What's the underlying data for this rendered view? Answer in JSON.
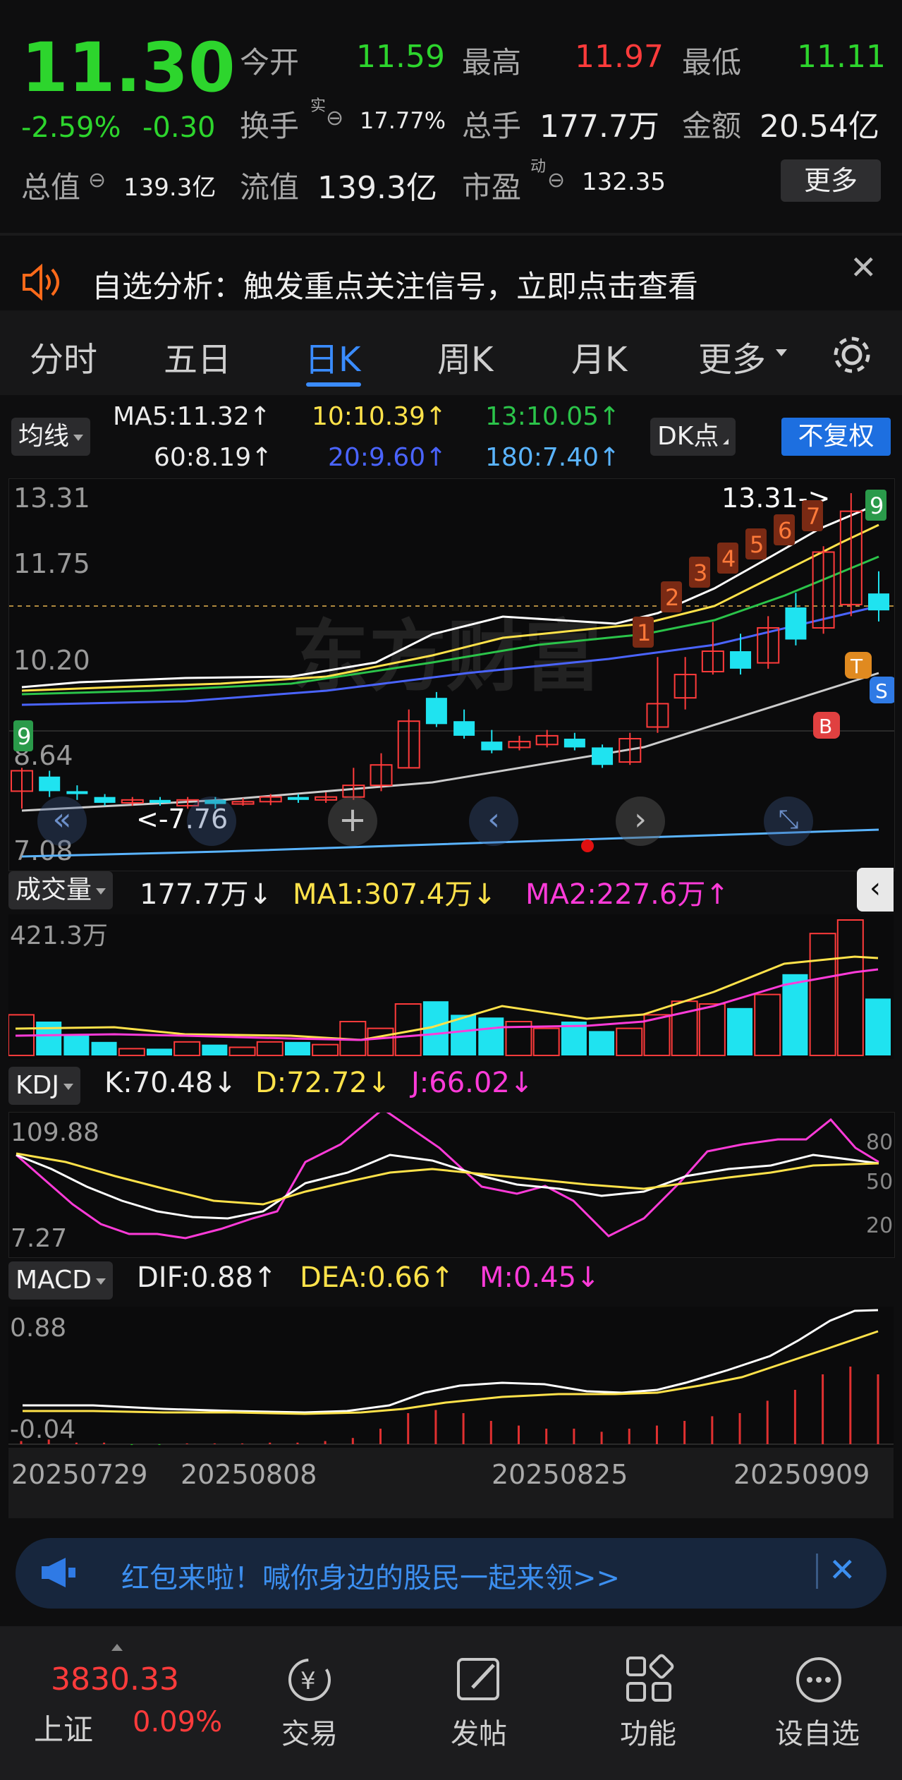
{
  "quote": {
    "price": "11.30",
    "change_pct": "-2.59%",
    "change": "-0.30",
    "open_label": "今开",
    "open": "11.59",
    "high_label": "最高",
    "high": "11.97",
    "low_label": "最低",
    "low": "11.11",
    "turnover_label": "换手",
    "turnover_sup": "实",
    "turnover": "17.77%",
    "volume_label": "总手",
    "volume": "177.7万",
    "amount_label": "金额",
    "amount": "20.54亿",
    "mktcap_label": "总值",
    "mktcap": "139.3亿",
    "float_label": "流值",
    "float": "139.3亿",
    "pe_label": "市盈",
    "pe_sup": "动",
    "pe": "132.35",
    "more_button": "更多"
  },
  "notice": {
    "text": "自选分析：触发重点关注信号，立即点击查看"
  },
  "tabs": [
    "分时",
    "五日",
    "日K",
    "周K",
    "月K",
    "更多"
  ],
  "active_tab": "日K",
  "ma_panel": {
    "selector": "均线",
    "ma5": "MA5:11.32↑",
    "ma10": "10:10.39↑",
    "ma13": "13:10.05↑",
    "ma60": "60:8.19↑",
    "ma20": "20:9.60↑",
    "ma180": "180:7.40↑",
    "dk_button": "DK点",
    "fq_button": "不复权"
  },
  "price_chart_labels": {
    "y_top": "13.31",
    "y_2": "11.75",
    "y_3": "10.20",
    "y_4": "8.64",
    "y_bottom": "7.08",
    "high_marker": "13.31->",
    "low_marker": "<-7.76",
    "watermark": "东方财富"
  },
  "volume_panel": {
    "selector": "成交量",
    "vol": "177.7万↓",
    "ma1": "MA1:307.4万↓",
    "ma2": "MA2:227.6万↑",
    "y_max": "421.3万"
  },
  "kdj_panel": {
    "selector": "KDJ",
    "k": "K:70.48↓",
    "d": "D:72.72↓",
    "j": "J:66.02↓",
    "y_top": "109.88",
    "y_bottom": "7.27",
    "lvl80": "80",
    "lvl50": "50",
    "lvl20": "20"
  },
  "macd_panel": {
    "selector": "MACD",
    "dif": "DIF:0.88↑",
    "dea": "DEA:0.66↑",
    "m": "M:0.45↓",
    "y_top": "0.88",
    "y_bottom": "-0.04"
  },
  "dates": [
    "20250729",
    "20250808",
    "20250825",
    "20250909"
  ],
  "banner": {
    "text": "红包来啦！喊你身边的股民一起来领>>"
  },
  "bottom_nav": {
    "index_value": "3830.33",
    "index_name": "上证",
    "index_change": "0.09%",
    "items": [
      "交易",
      "发帖",
      "功能",
      "设自选"
    ]
  },
  "chart_data": {
    "type": "candlestick",
    "candles": [
      {
        "o": 8.2,
        "c": 8.55,
        "h": 8.6,
        "l": 7.9
      },
      {
        "o": 8.45,
        "c": 8.2,
        "h": 8.55,
        "l": 8.1
      },
      {
        "o": 8.2,
        "c": 8.15,
        "h": 8.3,
        "l": 8.05
      },
      {
        "o": 8.1,
        "c": 8.0,
        "h": 8.15,
        "l": 7.95
      },
      {
        "o": 8.0,
        "c": 8.05,
        "h": 8.1,
        "l": 7.95
      },
      {
        "o": 8.05,
        "c": 8.0,
        "h": 8.1,
        "l": 7.95
      },
      {
        "o": 7.95,
        "c": 8.05,
        "h": 8.1,
        "l": 7.9
      },
      {
        "o": 8.05,
        "c": 7.98,
        "h": 8.1,
        "l": 7.9
      },
      {
        "o": 7.98,
        "c": 8.02,
        "h": 8.08,
        "l": 7.95
      },
      {
        "o": 8.02,
        "c": 8.1,
        "h": 8.15,
        "l": 7.96
      },
      {
        "o": 8.1,
        "c": 8.05,
        "h": 8.15,
        "l": 8.0
      },
      {
        "o": 8.05,
        "c": 8.1,
        "h": 8.18,
        "l": 8.0
      },
      {
        "o": 8.1,
        "c": 8.3,
        "h": 8.6,
        "l": 8.05
      },
      {
        "o": 8.3,
        "c": 8.65,
        "h": 8.85,
        "l": 8.2
      },
      {
        "o": 8.6,
        "c": 9.4,
        "h": 9.6,
        "l": 8.6
      },
      {
        "o": 9.8,
        "c": 9.35,
        "h": 9.9,
        "l": 9.3
      },
      {
        "o": 9.4,
        "c": 9.15,
        "h": 9.6,
        "l": 9.1
      },
      {
        "o": 9.05,
        "c": 8.9,
        "h": 9.25,
        "l": 8.85
      },
      {
        "o": 8.95,
        "c": 9.05,
        "h": 9.15,
        "l": 8.9
      },
      {
        "o": 9.0,
        "c": 9.15,
        "h": 9.25,
        "l": 8.95
      },
      {
        "o": 9.1,
        "c": 8.95,
        "h": 9.2,
        "l": 8.9
      },
      {
        "o": 8.95,
        "c": 8.65,
        "h": 9.0,
        "l": 8.6
      },
      {
        "o": 8.7,
        "c": 9.1,
        "h": 9.2,
        "l": 8.65
      },
      {
        "o": 9.3,
        "c": 9.7,
        "h": 10.5,
        "l": 9.2
      },
      {
        "o": 9.8,
        "c": 10.2,
        "h": 10.5,
        "l": 9.6
      },
      {
        "o": 10.25,
        "c": 10.6,
        "h": 11.1,
        "l": 10.2
      },
      {
        "o": 10.6,
        "c": 10.3,
        "h": 10.9,
        "l": 10.2
      },
      {
        "o": 10.4,
        "c": 11.0,
        "h": 11.2,
        "l": 10.3
      },
      {
        "o": 11.35,
        "c": 10.8,
        "h": 11.6,
        "l": 10.7
      },
      {
        "o": 11.0,
        "c": 12.3,
        "h": 12.4,
        "l": 10.9
      },
      {
        "o": 11.4,
        "c": 13.0,
        "h": 13.31,
        "l": 11.2
      },
      {
        "o": 11.59,
        "c": 11.3,
        "h": 11.97,
        "l": 11.11
      }
    ],
    "y_range": [
      7.08,
      13.31
    ],
    "volume_max": "421.3万"
  }
}
